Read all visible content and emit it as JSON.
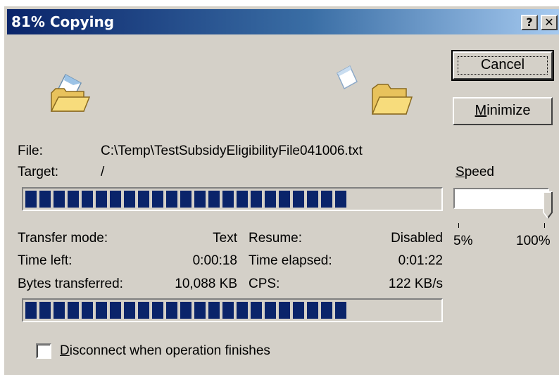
{
  "window": {
    "title": "81% Copying",
    "help_label": "?",
    "close_label": "✕"
  },
  "buttons": {
    "cancel_label": "Cancel",
    "minimize_mnemonic": "M",
    "minimize_rest": "inimize"
  },
  "file_info": {
    "file_label": "File:",
    "file_value": "C:\\Temp\\TestSubsidyEligibilityFile041006.txt",
    "target_label": "Target:",
    "target_value": "/"
  },
  "progress": {
    "file_fraction": 0.81,
    "total_fraction": 0.81
  },
  "stats": {
    "transfer_mode_label": "Transfer mode:",
    "transfer_mode_value": "Text",
    "resume_label": "Resume:",
    "resume_value": "Disabled",
    "time_left_label": "Time left:",
    "time_left_value": "0:00:18",
    "time_elapsed_label": "Time elapsed:",
    "time_elapsed_value": "0:01:22",
    "bytes_label": "Bytes transferred:",
    "bytes_value": "10,088 KB",
    "cps_label": "CPS:",
    "cps_value": "122 KB/s"
  },
  "speed": {
    "label_mnemonic": "S",
    "label_rest": "peed",
    "min_label": "5%",
    "max_label": "100%",
    "value_percent": 100
  },
  "option": {
    "disconnect_mnemonic": "D",
    "disconnect_rest": "isconnect when operation finishes",
    "disconnect_checked": false
  },
  "icons": {
    "source": "open-folder-icon",
    "flying": "document-icon",
    "target": "folder-icon"
  }
}
